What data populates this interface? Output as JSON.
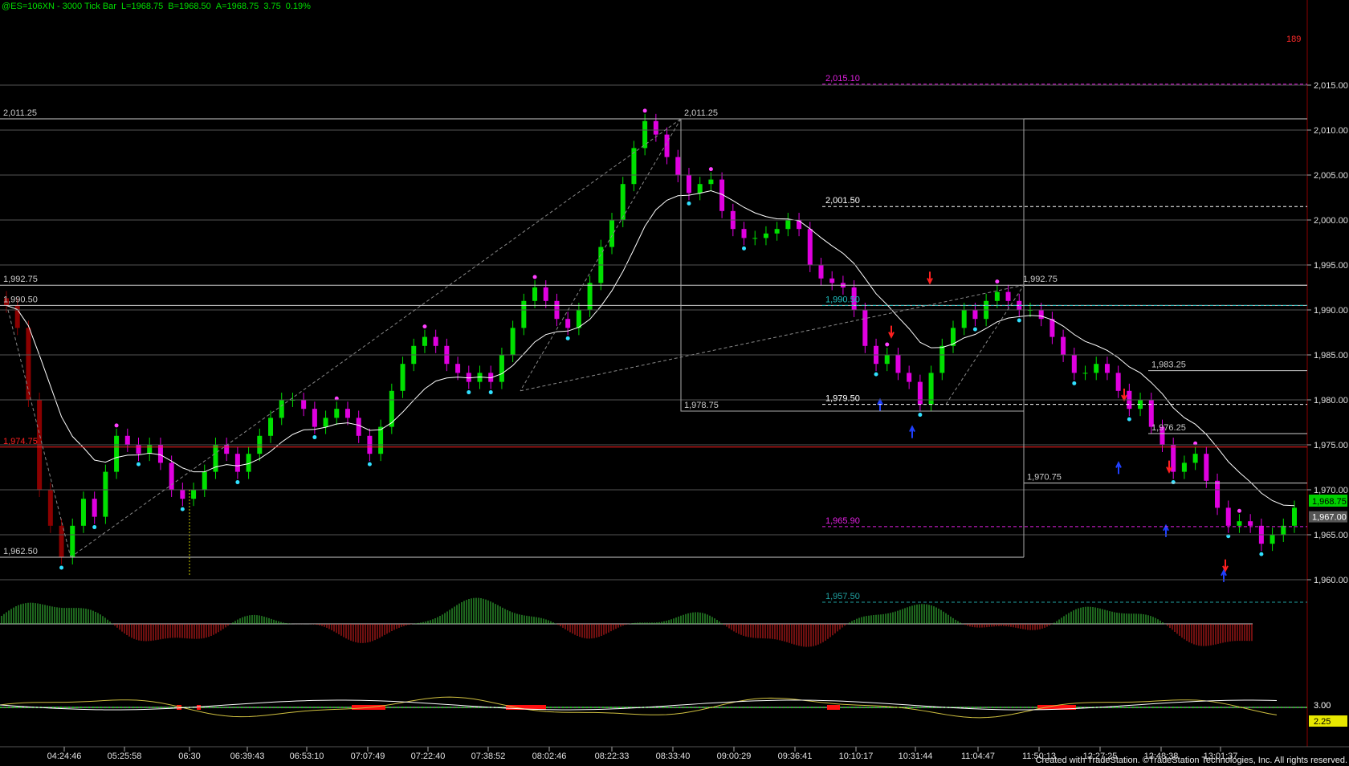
{
  "header": {
    "symbol": "@ES=106XN - 3000 Tick Bar",
    "last": "L=1968.75",
    "bid": "B=1968.50",
    "ask": "A=1968.75",
    "change": "3.75",
    "change_pct": "0.19%"
  },
  "footer": "Created with TradeStation. ©TradeStation Technologies, Inc. All rights reserved.",
  "bar_counter": "189",
  "colors": {
    "up": "#00e000",
    "down": "#e000e0",
    "dark_down": "#8b0000",
    "avg": "#ffffff",
    "osc_pos": "#3ccc3c",
    "osc_neg": "#e02020",
    "dot_top": "#ff40ff",
    "dot_bottom": "#30e0ff"
  },
  "chart_data": {
    "type": "candlestick",
    "x_tick_labels": [
      "04:24:46",
      "05:25:58",
      "06:30",
      "06:39:43",
      "06:53:10",
      "07:07:49",
      "07:22:40",
      "07:38:52",
      "08:02:46",
      "08:22:33",
      "08:33:40",
      "09:00:29",
      "09:36:41",
      "10:10:17",
      "10:31:44",
      "11:04:47",
      "11:50:13",
      "12:27:25",
      "12:48:38",
      "13:01:37"
    ],
    "y_axis": {
      "min": 1955,
      "max": 2017,
      "ticks": [
        "2,015.00",
        "2,010.00",
        "2,005.00",
        "2,000.00",
        "1,995.00",
        "1,990.00",
        "1,985.00",
        "1,980.00",
        "1,975.00",
        "1,970.00",
        "1,965.00",
        "1,960.00"
      ]
    },
    "last_price_label": "1,968.75",
    "second_price_label": "1,967.00",
    "close_path": [
      1990.5,
      1988,
      1980,
      1970,
      1966,
      1962.5,
      1966,
      1969,
      1967,
      1972,
      1976,
      1975,
      1974,
      1975,
      1973,
      1970,
      1969,
      1970,
      1972,
      1975,
      1974,
      1972,
      1974,
      1976,
      1978,
      1980,
      1980,
      1979,
      1977,
      1978,
      1979,
      1978,
      1976,
      1974,
      1977,
      1981,
      1984,
      1986,
      1987,
      1986,
      1984,
      1983,
      1982,
      1983,
      1982,
      1985,
      1988,
      1991,
      1992.5,
      1991,
      1989,
      1988,
      1990,
      1993,
      1997,
      2000,
      2004,
      2008,
      2011,
      2009.5,
      2007,
      2005,
      2003,
      2004,
      2004.5,
      2001,
      1999,
      1998,
      1998,
      1998.5,
      1999,
      2000,
      1999,
      1995,
      1993.5,
      1993,
      1992.5,
      1990,
      1986,
      1984,
      1985,
      1983,
      1982,
      1979.5,
      1983,
      1986,
      1988,
      1990,
      1989,
      1991,
      1992,
      1991,
      1990,
      1990,
      1989,
      1987,
      1985,
      1983,
      1983,
      1984,
      1983,
      1981,
      1979,
      1980,
      1977,
      1975,
      1972,
      1973,
      1974,
      1971,
      1968,
      1966,
      1966.5,
      1966,
      1964,
      1965,
      1966,
      1968
    ]
  },
  "levels": [
    {
      "label": "2,015.10",
      "value": 2015.1,
      "color": "#e020e0"
    },
    {
      "label": "2,011.25",
      "value": 2011.25,
      "color": "#cccccc"
    },
    {
      "label": "2,011.25",
      "value": 2011.25,
      "color": "#cccccc"
    },
    {
      "label": "2,001.50",
      "value": 2001.5,
      "color": "#ffffff"
    },
    {
      "label": "1,992.75",
      "value": 1992.75,
      "color": "#cccccc"
    },
    {
      "label": "1,992.75",
      "value": 1992.75,
      "color": "#cccccc"
    },
    {
      "label": "1,990.50",
      "value": 1990.5,
      "color": "#cccccc"
    },
    {
      "label": "1,990.50",
      "value": 1990.5,
      "color": "#20c0c0"
    },
    {
      "label": "1,983.25",
      "value": 1983.25,
      "color": "#cccccc"
    },
    {
      "label": "1,979.50",
      "value": 1979.5,
      "color": "#ffffff"
    },
    {
      "label": "1,978.75",
      "value": 1978.75,
      "color": "#cccccc"
    },
    {
      "label": "1,976.25",
      "value": 1976.25,
      "color": "#cccccc"
    },
    {
      "label": "1,974.75",
      "value": 1974.75,
      "color": "#ff2020"
    },
    {
      "label": "1,970.75",
      "value": 1970.75,
      "color": "#cccccc"
    },
    {
      "label": "1,965.90",
      "value": 1965.9,
      "color": "#e020e0"
    },
    {
      "label": "1,962.50",
      "value": 1962.5,
      "color": "#cccccc"
    },
    {
      "label": "1,957.50",
      "value": 1957.5,
      "color": "#20a0a0"
    }
  ],
  "lower_panel": {
    "labels": [
      "3.00",
      "2.25"
    ]
  }
}
